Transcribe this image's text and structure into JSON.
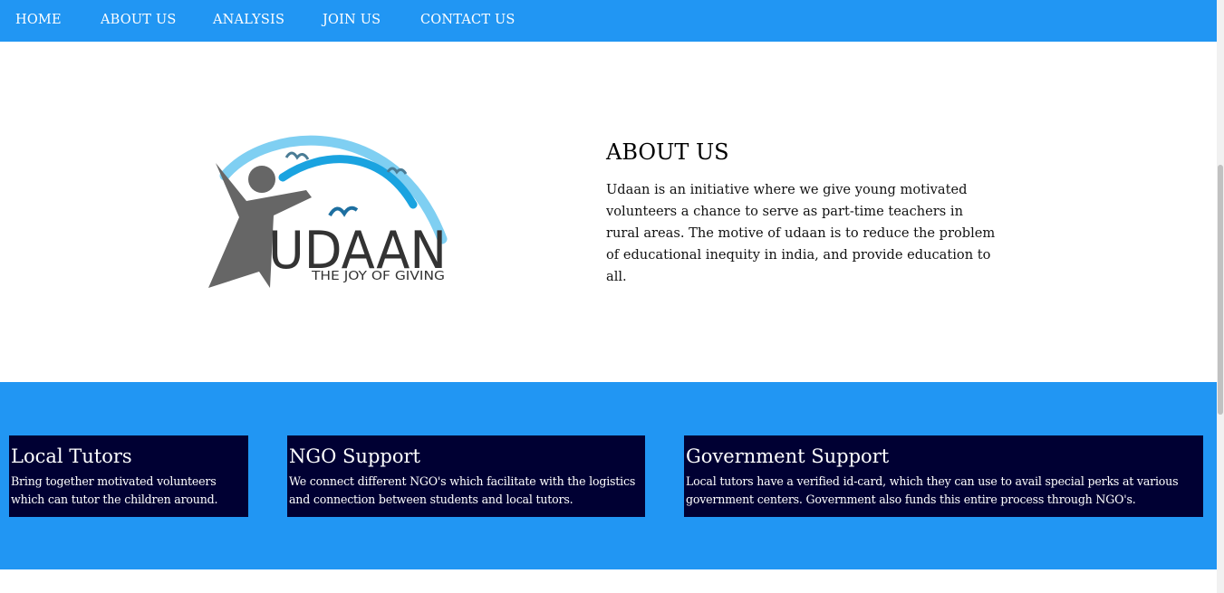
{
  "nav": {
    "items": [
      {
        "label": "HOME"
      },
      {
        "label": "ABOUT US"
      },
      {
        "label": "ANALYSIS"
      },
      {
        "label": "JOIN US"
      },
      {
        "label": "CONTACT US"
      }
    ]
  },
  "logo": {
    "name": "UDAAN",
    "tagline": "THE JOY OF GIVING"
  },
  "about": {
    "heading": "ABOUT US",
    "text": "Udaan is an initiative where we give young motivated volunteers a chance to serve as part-time teachers in rural areas. The motive of udaan is to reduce the problem of educational inequity in india, and provide education to all."
  },
  "features": [
    {
      "title": "Local Tutors",
      "text": "Bring together motivated volunteers which can tutor the children around."
    },
    {
      "title": "NGO Support",
      "text": "We connect different NGO's which facilitate with the logistics and connection between students and local tutors."
    },
    {
      "title": "Government Support",
      "text": "Local tutors have a verified id-card, which they can use to avail special perks at various government centers. Government also funds this entire process through NGO's."
    }
  ],
  "colors": {
    "primary": "#2196f3",
    "card_bg": "#000033",
    "logo_arc_light": "#7fcff2",
    "logo_arc_dark": "#1aa3e0",
    "logo_gray": "#666666"
  }
}
